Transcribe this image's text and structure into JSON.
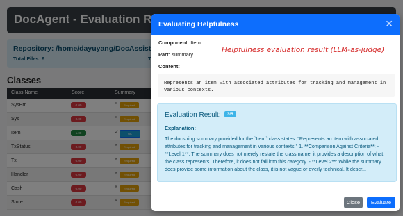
{
  "app": {
    "title": "DocAgent - Evaluation Results",
    "repository_label": "Repository: /home/dayuyang/DocAssist/data/te",
    "total_files_label": "Total Files: 9",
    "total_right_fragment": "T",
    "classes_heading": "Classes"
  },
  "table": {
    "headers": [
      "Class Name",
      "Score",
      "Summary"
    ],
    "rows": [
      {
        "name": "SysErr",
        "score": "0.00",
        "mark": "×",
        "status": "Required"
      },
      {
        "name": "Sys",
        "score": "0.00",
        "mark": "×",
        "status": "Required"
      },
      {
        "name": "Item",
        "score": "1.00",
        "mark": "✓",
        "status": "OK"
      },
      {
        "name": "TxStatus",
        "score": "0.00",
        "mark": "×",
        "status": "Required"
      },
      {
        "name": "Tx",
        "score": "0.00",
        "mark": "×",
        "status": "Required"
      },
      {
        "name": "Handler",
        "score": "0.00",
        "mark": "×",
        "status": "Required"
      },
      {
        "name": "Cash",
        "score": "0.00",
        "mark": "×",
        "status": "Required"
      },
      {
        "name": "Store",
        "score": "0.00",
        "mark": "×",
        "status": "Required"
      }
    ]
  },
  "modal": {
    "title": "Evaluating Helpfulness",
    "close_icon": "close-icon",
    "component_label": "Component:",
    "component_value": "Item",
    "part_label": "Part:",
    "part_value": "summary",
    "content_label": "Content:",
    "annotation": "Helpfulness evaluation result (LLM-as-judge)",
    "content_text": "Represents an item with associated attributes for tracking and management in various contexts.",
    "result_label": "Evaluation Result:",
    "result_score": "3/5",
    "explanation_label": "Explanation:",
    "explanation_text": "The docstring summary provided for the `Item` class states: \"Represents an item with associated attributes for tracking and management in various contexts.\" 1. **Comparison Against Criteria**: - **Level 1**: The summary does not merely restate the class name; it provides a description of what the class represents. Therefore, it does not fall into this category. - **Level 2**: While the summary does provide some information about the class, it is not vague or overly technical. It descr...",
    "close_button": "Close",
    "evaluate_button": "Evaluate"
  },
  "colors": {
    "primary": "#0d6efd",
    "fail_badge": "#d9363e",
    "pass_badge": "#208540",
    "required_badge": "#e3a008",
    "info_bg": "#d3edf9",
    "annotation": "#d62d2d"
  }
}
